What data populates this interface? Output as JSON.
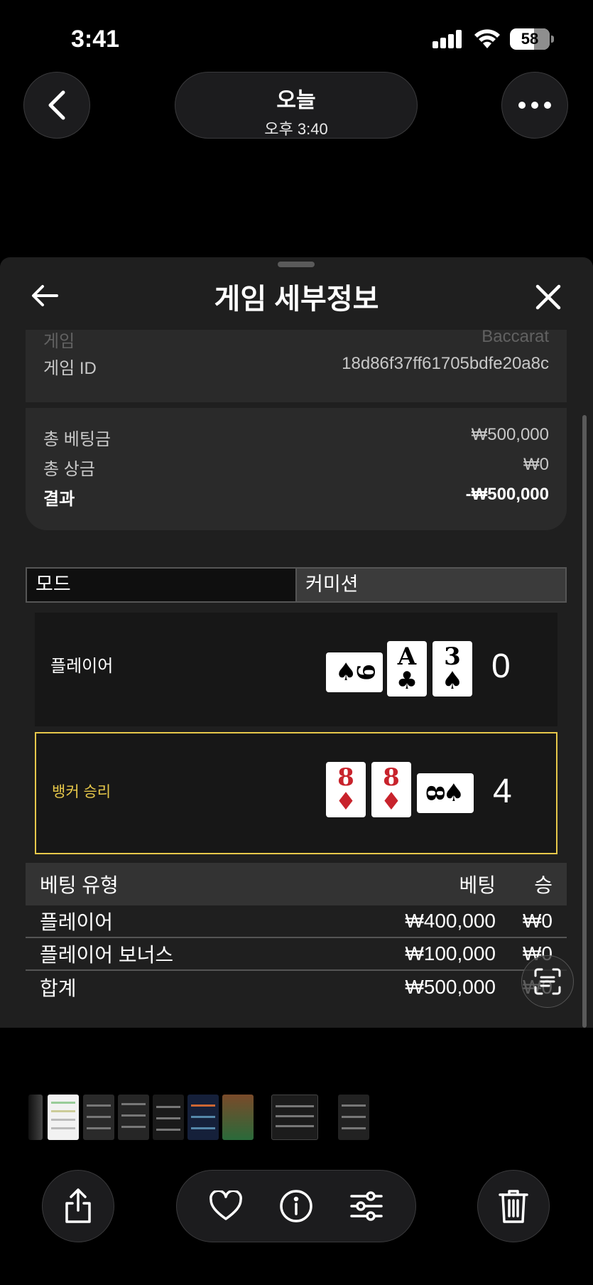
{
  "status_bar": {
    "time": "3:41",
    "battery": "58"
  },
  "photo_header": {
    "date": "오늘",
    "time": "오후 3:40"
  },
  "panel": {
    "title": "게임 세부정보",
    "info": [
      {
        "label": "게임",
        "value": "Baccarat"
      },
      {
        "label": "게임 ID",
        "value": "18d86f37ff61705bdfe20a8c"
      }
    ],
    "summary": [
      {
        "label": "총 베팅금",
        "value": "₩500,000"
      },
      {
        "label": "총 상금",
        "value": "₩0"
      },
      {
        "label": "결과",
        "value": "-₩500,000"
      }
    ],
    "tabs": [
      "모드",
      "커미션"
    ],
    "player": {
      "label": "플레이어",
      "score": "0",
      "cards": [
        {
          "rank": "9",
          "suit": "♠",
          "color": "black",
          "orientation": "sideways"
        },
        {
          "rank": "A",
          "suit": "♣",
          "color": "black",
          "orientation": "upright"
        },
        {
          "rank": "3",
          "suit": "♠",
          "color": "black",
          "orientation": "upright"
        }
      ]
    },
    "banker": {
      "label": "뱅커 승리",
      "score": "4",
      "cards": [
        {
          "rank": "8",
          "suit": "♦",
          "color": "red",
          "orientation": "upright"
        },
        {
          "rank": "8",
          "suit": "♦",
          "color": "red",
          "orientation": "upright"
        },
        {
          "rank": "8",
          "suit": "♠",
          "color": "black",
          "orientation": "sideways"
        }
      ]
    },
    "bet_table": {
      "headers": [
        "베팅 유형",
        "베팅",
        "승"
      ],
      "rows": [
        {
          "type": "플레이어",
          "bet": "₩400,000",
          "win": "₩0"
        },
        {
          "type": "플레이어 보너스",
          "bet": "₩100,000",
          "win": "₩0"
        },
        {
          "type": "합계",
          "bet": "₩500,000",
          "win": "₩0"
        }
      ]
    }
  },
  "colors": {
    "accent_gold": "#e7c84a",
    "card_red": "#c8232c",
    "panel_bg": "#1f1f1f"
  },
  "toolbar": [
    "share-icon",
    "heart-icon",
    "info-icon",
    "adjust-icon",
    "trash-icon"
  ]
}
